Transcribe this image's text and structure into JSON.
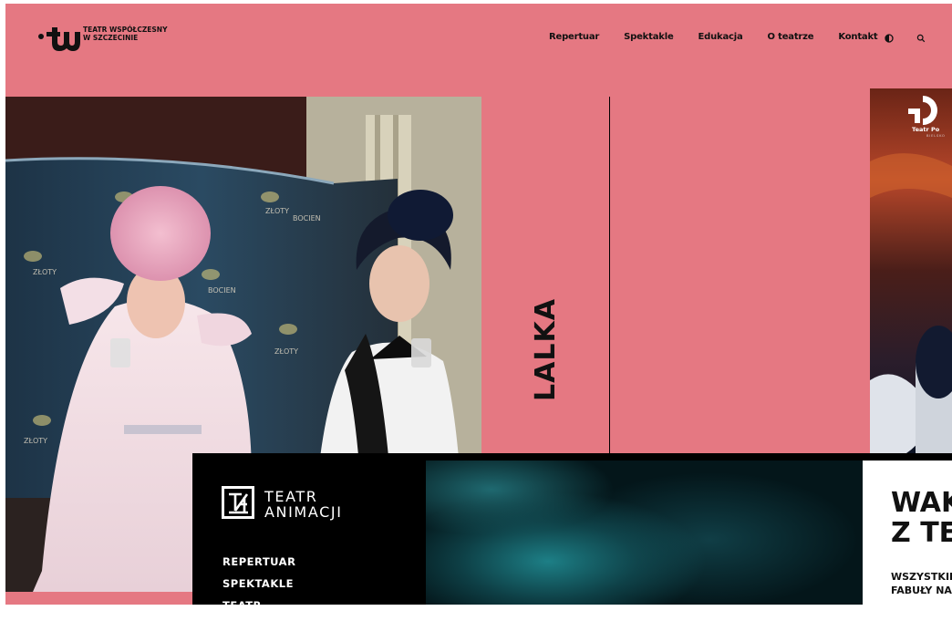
{
  "header": {
    "logo_text_line1": "TEATR WSPÓŁCZESNY",
    "logo_text_line2": "W SZCZECINIE",
    "nav": [
      "Repertuar",
      "Spektakle",
      "Edukacja",
      "O teatrze",
      "Kontakt"
    ],
    "icons": [
      "contrast-icon",
      "search-icon"
    ]
  },
  "slider": {
    "title": "LALKA",
    "side_logo_text": "Teatr Po",
    "side_logo_sub": "BIELSKO"
  },
  "animacji": {
    "name_line1": "TEATR",
    "name_line2": "ANIMACJI",
    "menu": [
      "REPERTUAR",
      "SPEKTAKLE",
      "TEATR"
    ]
  },
  "promo": {
    "title_line1": "WAK",
    "title_line2": "Z TE",
    "sub_line1": "WSZYSTKIE",
    "sub_line2": "FABUŁY NA"
  },
  "colors": {
    "accent_pink": "#e57882",
    "dark": "#000000"
  }
}
